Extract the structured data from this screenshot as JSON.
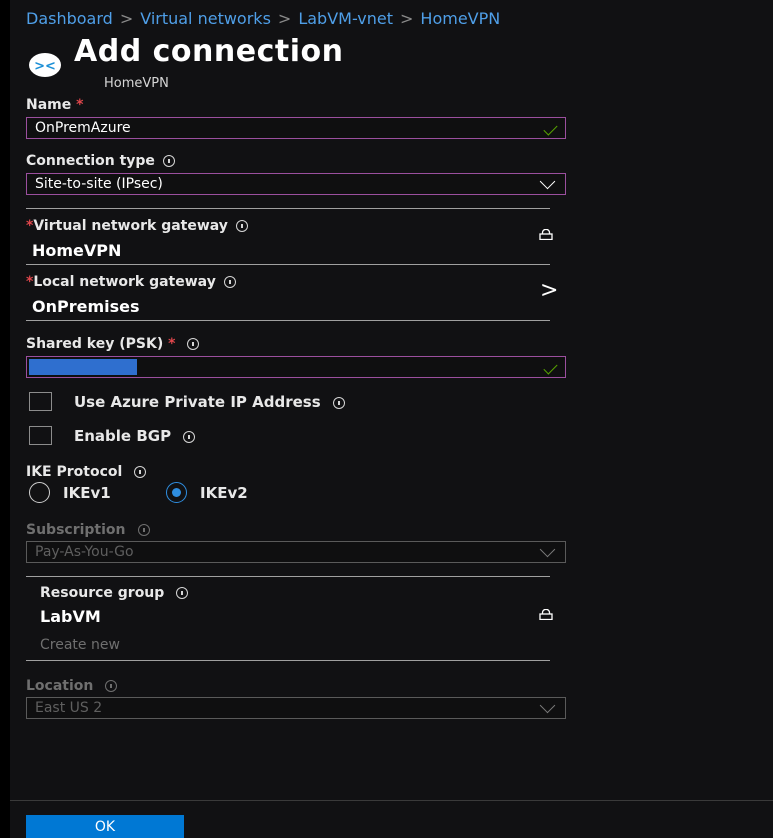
{
  "breadcrumb": [
    "Dashboard",
    "Virtual networks",
    "LabVM-vnet",
    "HomeVPN"
  ],
  "breadcrumb_separator": ">",
  "header": {
    "title": "Add connection",
    "subtitle": "HomeVPN",
    "icon": "connection-icon",
    "icon_glyph": "><"
  },
  "form": {
    "name": {
      "label": "Name",
      "value": "OnPremAzure"
    },
    "connection_type": {
      "label": "Connection type",
      "value": "Site-to-site (IPsec)"
    },
    "virtual_network_gateway": {
      "label": "Virtual network gateway",
      "value": "HomeVPN"
    },
    "local_network_gateway": {
      "label": "Local network gateway",
      "value": "OnPremises",
      "arrow": ">"
    },
    "shared_key": {
      "label": "Shared key (PSK)",
      "value": ""
    },
    "use_private_ip": {
      "label": "Use Azure Private IP Address",
      "checked": false
    },
    "enable_bgp": {
      "label": "Enable BGP",
      "checked": false
    },
    "ike_protocol": {
      "label": "IKE Protocol",
      "options": [
        "IKEv1",
        "IKEv2"
      ],
      "selected": "IKEv2"
    },
    "subscription": {
      "label": "Subscription",
      "value": "Pay-As-You-Go"
    },
    "resource_group": {
      "label": "Resource group",
      "value": "LabVM",
      "create_new": "Create new"
    },
    "location": {
      "label": "Location",
      "value": "East US 2"
    }
  },
  "footer": {
    "ok_label": "OK"
  },
  "colors": {
    "accent": "#0078d4",
    "link": "#4f9fe8",
    "field_border": "#9b4f9e",
    "required": "#e0474c",
    "valid": "#57a300",
    "background": "#111113"
  }
}
